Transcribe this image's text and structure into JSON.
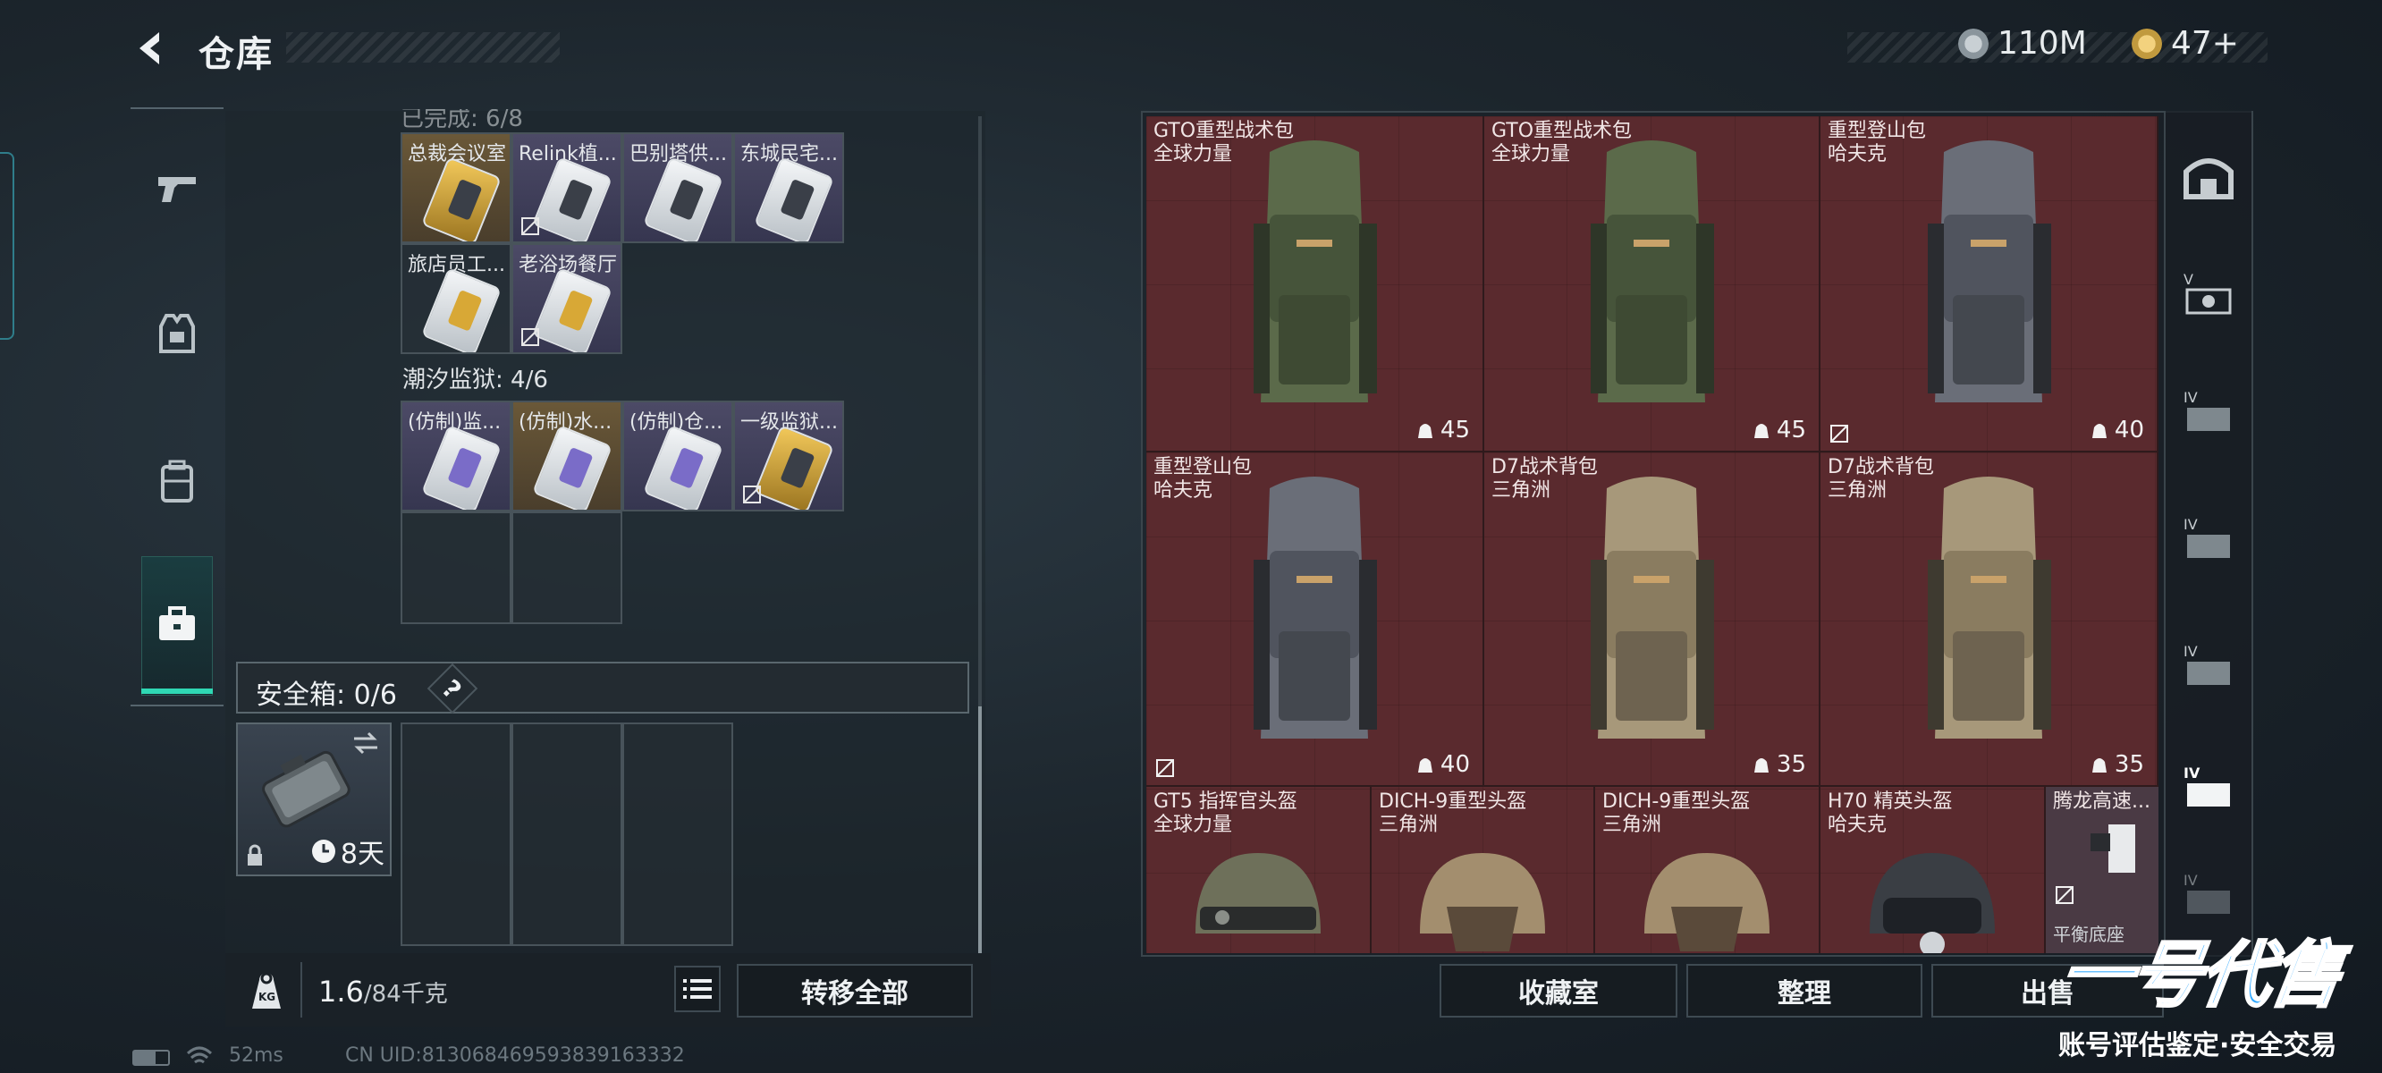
{
  "header": {
    "title": "仓库",
    "currency1": "110M",
    "currency2": "47+"
  },
  "left_nav": {
    "items": [
      "weapon",
      "equipment",
      "backpack",
      "toolbox"
    ]
  },
  "partial_header": "已完成: 6/8",
  "keys_group1": [
    {
      "name": "总裁会议室",
      "style": "gold"
    },
    {
      "name": "Relink植...",
      "style": "purple",
      "nosell": true
    },
    {
      "name": "巴别塔供...",
      "style": "purple"
    },
    {
      "name": "东城民宅...",
      "style": "purple"
    },
    {
      "name": "旅店员工...",
      "style": "normal"
    },
    {
      "name": "老浴场餐厅",
      "style": "purple",
      "nosell": true
    }
  ],
  "section2": {
    "label": "潮汐监狱: 4/6"
  },
  "keys_group2": [
    {
      "name": "(仿制)监...",
      "style": "purple"
    },
    {
      "name": "(仿制)水...",
      "style": "gold"
    },
    {
      "name": "(仿制)仓...",
      "style": "purple"
    },
    {
      "name": "一级监狱...",
      "style": "purple",
      "nosell": true
    }
  ],
  "safebox": {
    "label": "安全箱: 0/6",
    "help": "?",
    "days": "8天"
  },
  "footer": {
    "weight_value": "1.6",
    "weight_unit": "/84千克",
    "kg_label": "KG",
    "transfer_all": "转移全部"
  },
  "stash_items": [
    {
      "name": "GTO重型战术包",
      "brand": "全球力量",
      "count": "45",
      "color": "green",
      "nosell": false
    },
    {
      "name": "GTO重型战术包",
      "brand": "全球力量",
      "count": "45",
      "color": "green",
      "nosell": false
    },
    {
      "name": "重型登山包",
      "brand": "哈夫克",
      "count": "40",
      "color": "grey",
      "nosell": true
    },
    {
      "name": "重型登山包",
      "brand": "哈夫克",
      "count": "40",
      "color": "grey",
      "nosell": true
    },
    {
      "name": "D7战术背包",
      "brand": "三角洲",
      "count": "35",
      "color": "tan",
      "nosell": false
    },
    {
      "name": "D7战术背包",
      "brand": "三角洲",
      "count": "35",
      "color": "tan",
      "nosell": false
    }
  ],
  "helmets": [
    {
      "name": "GT5 指挥官头盔",
      "brand": "全球力量"
    },
    {
      "name": "DICH-9重型头盔",
      "brand": "三角洲"
    },
    {
      "name": "DICH-9重型头盔",
      "brand": "三角洲"
    },
    {
      "name": "H70 精英头盔",
      "brand": "哈夫克"
    }
  ],
  "partial_item": {
    "name": "腾龙高速...",
    "sub": "平衡底座"
  },
  "right_side_labels": [
    "V",
    "IV",
    "IV",
    "IV",
    "IV",
    "IV"
  ],
  "bottom_buttons": {
    "collection": "收藏室",
    "sort": "整理",
    "sell": "出售"
  },
  "status_bar": {
    "ping": "52ms",
    "uid": "CN UID:813068469593839163332"
  },
  "watermark": {
    "logo": "一号代售",
    "slogan": "账号评估鉴定·安全交易"
  }
}
